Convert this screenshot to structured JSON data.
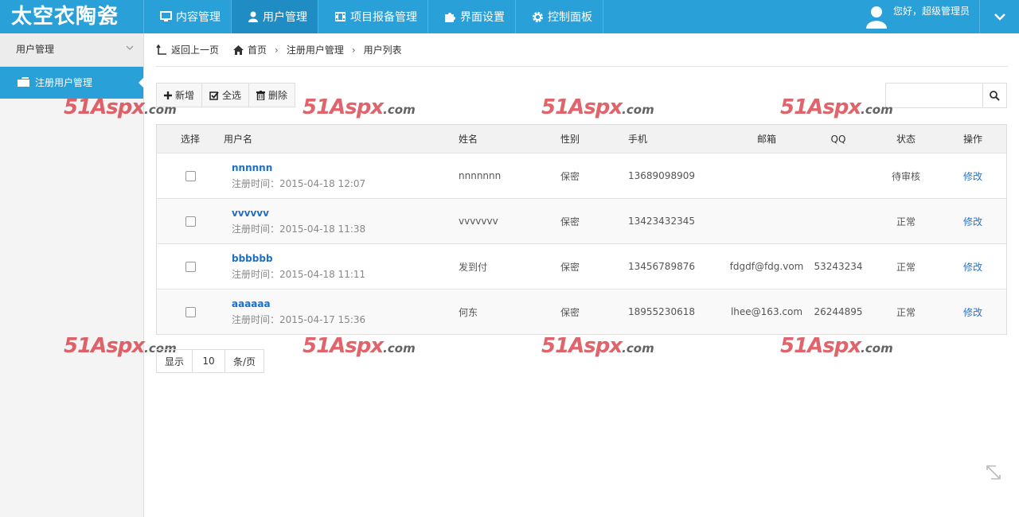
{
  "brand": "太空衣陶瓷",
  "nav": [
    {
      "label": "内容管理",
      "icon": "monitor-icon"
    },
    {
      "label": "用户管理",
      "icon": "user-icon",
      "active": true
    },
    {
      "label": "项目报备管理",
      "icon": "film-icon"
    },
    {
      "label": "界面设置",
      "icon": "puzzle-icon"
    },
    {
      "label": "控制面板",
      "icon": "gear-icon"
    }
  ],
  "user": {
    "greeting": "您好，超级管理员"
  },
  "sidebar": {
    "section": "用户管理",
    "items": [
      {
        "label": "注册用户管理",
        "icon": "folder-icon"
      }
    ]
  },
  "breadcrumb": {
    "back": "返回上一页",
    "home": "首页",
    "level1": "注册用户管理",
    "level2": "用户列表"
  },
  "toolbar": {
    "add": "新增",
    "select_all": "全选",
    "delete": "删除"
  },
  "search": {
    "value": "",
    "placeholder": ""
  },
  "watermark": {
    "brand": "51Aspx",
    "suffix": ".com"
  },
  "table": {
    "columns": [
      "选择",
      "用户名",
      "姓名",
      "性别",
      "手机",
      "邮箱",
      "QQ",
      "状态",
      "操作"
    ],
    "rows": [
      {
        "username": "nnnnnn",
        "regtime": "注册时间：2015-04-18 12:07",
        "name": "nnnnnnn",
        "gender": "保密",
        "phone": "13689098909",
        "email": "",
        "qq": "",
        "status": "待审核",
        "action": "修改"
      },
      {
        "username": "vvvvvv",
        "regtime": "注册时间：2015-04-18 11:38",
        "name": "vvvvvvv",
        "gender": "保密",
        "phone": "13423432345",
        "email": "",
        "qq": "",
        "status": "正常",
        "action": "修改"
      },
      {
        "username": "bbbbbb",
        "regtime": "注册时间：2015-04-18 11:11",
        "name": "发到付",
        "gender": "保密",
        "phone": "13456789876",
        "email": "fdgdf@fdg.vom",
        "qq": "53243234",
        "status": "正常",
        "action": "修改"
      },
      {
        "username": "aaaaaa",
        "regtime": "注册时间：2015-04-17 15:36",
        "name": "何东",
        "gender": "保密",
        "phone": "18955230618",
        "email": "lhee@163.com",
        "qq": "26244895",
        "status": "正常",
        "action": "修改"
      }
    ]
  },
  "pager": {
    "show": "显示",
    "size": "10",
    "unit": "条/页"
  },
  "colors": {
    "primary": "#29a0d8",
    "primary_dark": "#1f8cc4",
    "link": "#1e6fc6",
    "watermark": "#d22832"
  }
}
